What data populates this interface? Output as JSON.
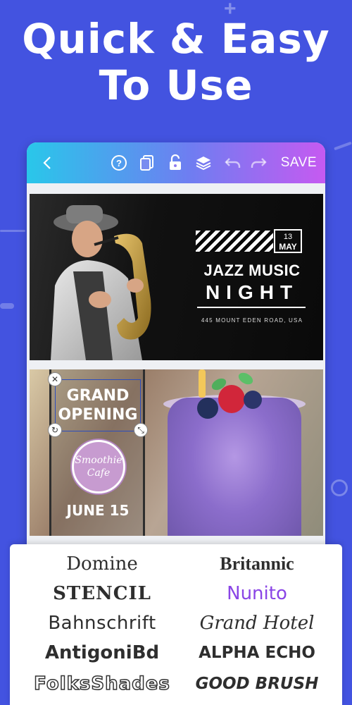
{
  "headline": {
    "line1": "Quick & Easy",
    "line2": "To Use"
  },
  "toolbar": {
    "back_icon": "chevron-left-icon",
    "help_icon": "help-icon",
    "copy_icon": "copy-icon",
    "lock_icon": "lock-icon",
    "layers_icon": "layers-icon",
    "undo_icon": "undo-icon",
    "redo_icon": "redo-icon",
    "save_label": "SAVE"
  },
  "jazz_card": {
    "date_day": "13",
    "date_month": "MAY",
    "title": "JAZZ MUSIC",
    "subtitle": "NIGHT",
    "address": "445 MOUNT EDEN ROAD, USA"
  },
  "smoothie_card": {
    "headline": "GRAND OPENING",
    "badge_line1": "Smoothie",
    "badge_line2": "Cafe",
    "date": "JUNE 15"
  },
  "fonts": [
    {
      "name": "Domine"
    },
    {
      "name": "Britannic"
    },
    {
      "name": "STENCIL"
    },
    {
      "name": "Nunito"
    },
    {
      "name": "Bahnschrift"
    },
    {
      "name": "Grand Hotel"
    },
    {
      "name": "AntigoniBd"
    },
    {
      "name": "ALPHA ECHO"
    },
    {
      "name": "FolksShades"
    },
    {
      "name": "GOOD BRUSH"
    }
  ],
  "colors": {
    "background": "#4353e0",
    "accent_selected_font": "#8a45e6",
    "toolbar_gradient_start": "#29c7ea",
    "toolbar_gradient_end": "#c65af1"
  }
}
